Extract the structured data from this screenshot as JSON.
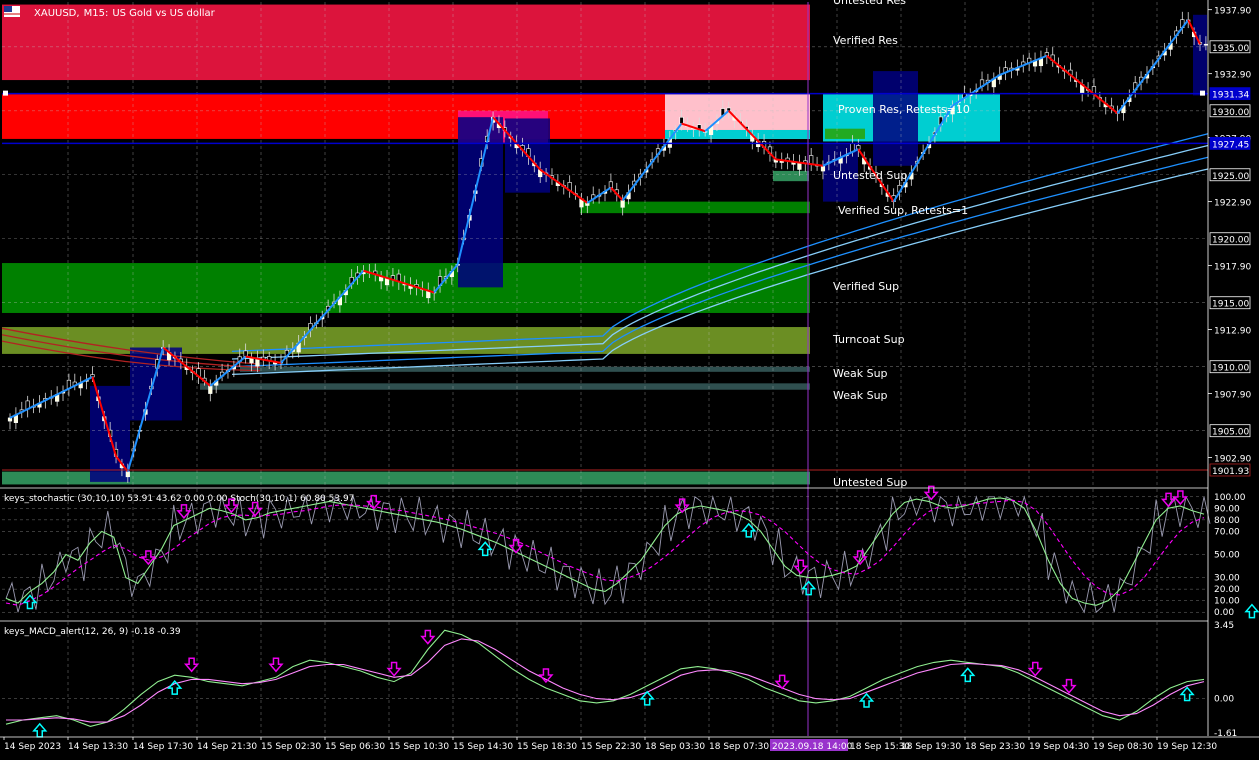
{
  "window": {
    "symbol": "XAUUSD",
    "timeframe": "M15",
    "description": "US Gold vs US dollar",
    "title_sep": ",",
    "title_sep2": ":"
  },
  "colors": {
    "bg": "#000000",
    "grid": "#c0c0c0",
    "axis": "#ffffff",
    "resistance_strong": "#dc143c",
    "resistance_proven": "#ff0000",
    "support_verified": "#008000",
    "support_turncoat": "#6b8e23",
    "support_weak": "#2f4f4f",
    "support_untested": "#2e8b57",
    "ma_blue": "#1e90ff",
    "ma_red": "#b22222",
    "zigzag_up": "#1e90ff",
    "zigzag_down": "#ff0000",
    "candle_bull": "#ffffe0",
    "candle_bear": "#ffffff",
    "stoch_main": "#90ee90",
    "stoch_signal": "#ff00ff",
    "arrow_up": "#00ffff",
    "arrow_down": "#ee00ee",
    "level_line": "#0000cd",
    "cursor_line": "#9932cc",
    "cursor_label_bg": "#9932cc"
  },
  "chart_data": [
    {
      "type": "candlestick",
      "title": "XAUUSD, M15: US Gold vs US dollar",
      "ylim": [
        1900.6,
        1938.5
      ],
      "y_ticks": [
        "1937.90",
        "1935.00",
        "1932.90",
        "1930.00",
        "1927.90",
        "1925.00",
        "1922.90",
        "1920.00",
        "1917.90",
        "1915.00",
        "1912.90",
        "1910.00",
        "1907.90",
        "1905.00",
        "1902.90",
        "1901.93"
      ],
      "price_labels_highlighted": [
        {
          "label": "1935.00",
          "value": 1935.0,
          "style": "plain"
        },
        {
          "label": "1931.34",
          "value": 1931.34,
          "style": "blue"
        },
        {
          "label": "1930.00",
          "value": 1930.0,
          "style": "plain"
        },
        {
          "label": "1927.45",
          "value": 1927.45,
          "style": "blue"
        },
        {
          "label": "1925.00",
          "value": 1925.0,
          "style": "plain"
        },
        {
          "label": "1920.00",
          "value": 1920.0,
          "style": "plain"
        },
        {
          "label": "1915.00",
          "value": 1915.0,
          "style": "plain"
        },
        {
          "label": "1910.00",
          "value": 1910.0,
          "style": "plain"
        },
        {
          "label": "1905.00",
          "value": 1905.0,
          "style": "plain"
        },
        {
          "label": "1901.93",
          "value": 1901.93,
          "style": "current"
        }
      ],
      "horizontal_lines": [
        1931.34,
        1927.45
      ],
      "zones": [
        {
          "name": "Untested Res",
          "label": "Untested Res",
          "low": 1938.5,
          "high": 1938.5,
          "kind": "untested_res"
        },
        {
          "name": "Verified Res",
          "label": "Verified Res",
          "low": 1932.4,
          "high": 1938.3,
          "kind": "resistance_strong"
        },
        {
          "name": "Proven Res",
          "label": "Proven Res, Retests=10",
          "low": 1927.8,
          "high": 1931.3,
          "kind": "resistance_proven"
        },
        {
          "name": "Untested Sup",
          "label": "Untested Sup",
          "low": 1924.8,
          "high": 1924.8,
          "kind": "untested_sup_label"
        },
        {
          "name": "Verified Sup 1",
          "label": "Verified Sup, Retests=1",
          "low": 1922.0,
          "high": 1922.9,
          "kind": "support_verified"
        },
        {
          "name": "Verified Sup 2",
          "label": "Verified Sup",
          "low": 1914.2,
          "high": 1918.1,
          "kind": "support_verified"
        },
        {
          "name": "Turncoat Sup",
          "label": "Turncoat Sup",
          "low": 1911.0,
          "high": 1913.1,
          "kind": "support_turncoat"
        },
        {
          "name": "Weak Sup 1",
          "label": "Weak Sup",
          "low": 1909.6,
          "high": 1910.0,
          "kind": "support_weak"
        },
        {
          "name": "Weak Sup 2",
          "label": "Weak Sup",
          "low": 1908.2,
          "high": 1908.7,
          "kind": "support_weak"
        },
        {
          "name": "Untested Sup 2",
          "label": "Untested Sup",
          "low": 1900.8,
          "high": 1901.8,
          "kind": "support_untested"
        }
      ],
      "x_labels": [
        "14 Sep 2023",
        "14 Sep 13:30",
        "14 Sep 17:30",
        "14 Sep 21:30",
        "15 Sep 02:30",
        "15 Sep 06:30",
        "15 Sep 10:30",
        "15 Sep 14:30",
        "15 Sep 18:30",
        "15 Sep 22:30",
        "18 Sep 03:30",
        "18 Sep 07:30",
        "2023.09.18 14:00",
        "18 Sep 15:30",
        "18 Sep 19:30",
        "18 Sep 23:30",
        "19 Sep 04:30",
        "19 Sep 08:30",
        "19 Sep 12:30"
      ],
      "cursor_label": "2023.09.18 14:00",
      "zigzag": [
        [
          0,
          1906.0
        ],
        [
          7,
          1909.2
        ],
        [
          9,
          1903.0
        ],
        [
          10,
          1901.8
        ],
        [
          13,
          1911.5
        ],
        [
          17,
          1908.5
        ],
        [
          20,
          1910.8
        ],
        [
          23,
          1910.3
        ],
        [
          30,
          1917.5
        ],
        [
          36,
          1915.8
        ],
        [
          38,
          1918.0
        ],
        [
          41,
          1929.5
        ],
        [
          45,
          1925.4
        ],
        [
          49,
          1922.8
        ],
        [
          51,
          1924.0
        ],
        [
          52,
          1923.0
        ],
        [
          57,
          1929.0
        ],
        [
          59,
          1928.4
        ],
        [
          61,
          1930.0
        ],
        [
          65,
          1926.2
        ],
        [
          69,
          1925.7
        ],
        [
          72,
          1927.0
        ],
        [
          75,
          1922.9
        ],
        [
          80,
          1930.4
        ],
        [
          84,
          1932.8
        ],
        [
          88,
          1934.3
        ],
        [
          94,
          1929.8
        ],
        [
          100,
          1937.1
        ],
        [
          101,
          1935.2
        ]
      ],
      "close_series_note": "price path",
      "overlay_labels": {
        "untested_res": "Untested Res",
        "verified_res": "Verified Res",
        "proven_res": "Proven Res, Retests=10",
        "untested_sup": "Untested Sup",
        "verified_sup_retests": "Verified Sup, Retests=1",
        "verified_sup": "Verified Sup",
        "turncoat_sup": "Turncoat Sup",
        "weak_sup_1": "Weak Sup",
        "weak_sup_2": "Weak Sup",
        "untested_sup_bottom": "Untested Sup"
      }
    },
    {
      "type": "line",
      "title": "keys_stochastic (30,10,10) 53.91 43.62 0.00 0.00 Stoch(30,10,1) 60.80 53.97",
      "ylim": [
        -5,
        105
      ],
      "y_ticks": [
        "100.00",
        "90.00",
        "80.00",
        "70.00",
        "50.00",
        "30.00",
        "20.00",
        "10.00",
        "0.00"
      ],
      "levels": [
        100,
        90,
        80,
        70,
        50,
        30,
        20,
        10,
        0
      ],
      "series": [
        {
          "name": "main",
          "values": [
            12,
            8,
            18,
            25,
            35,
            50,
            45,
            60,
            70,
            65,
            30,
            25,
            40,
            55,
            75,
            80,
            85,
            90,
            88,
            85,
            80,
            82,
            86,
            88,
            90,
            92,
            94,
            96,
            94,
            92,
            90,
            88,
            86,
            84,
            82,
            80,
            78,
            75,
            72,
            68,
            64,
            60,
            55,
            50,
            45,
            40,
            35,
            30,
            25,
            20,
            18,
            25,
            35,
            45,
            60,
            75,
            85,
            90,
            92,
            90,
            88,
            85,
            80,
            70,
            55,
            40,
            32,
            30,
            30,
            32,
            35,
            40,
            55,
            70,
            85,
            95,
            98,
            96,
            92,
            90,
            92,
            95,
            98,
            99,
            97,
            90,
            70,
            45,
            25,
            12,
            8,
            6,
            10,
            20,
            40,
            60,
            80,
            90,
            92,
            88,
            85
          ]
        },
        {
          "name": "signal",
          "values": [
            8,
            6,
            10,
            15,
            22,
            30,
            38,
            45,
            52,
            58,
            55,
            48,
            45,
            48,
            55,
            63,
            70,
            77,
            82,
            84,
            84,
            83,
            84,
            85,
            87,
            88,
            90,
            92,
            93,
            93,
            92,
            91,
            89,
            88,
            86,
            84,
            82,
            80,
            77,
            74,
            71,
            68,
            64,
            60,
            55,
            50,
            45,
            40,
            36,
            32,
            28,
            27,
            30,
            34,
            40,
            48,
            57,
            66,
            75,
            82,
            86,
            88,
            87,
            84,
            78,
            70,
            60,
            50,
            42,
            37,
            34,
            33,
            38,
            45,
            56,
            68,
            79,
            87,
            92,
            93,
            93,
            94,
            95,
            96,
            97,
            95,
            88,
            75,
            60,
            45,
            32,
            22,
            16,
            15,
            20,
            30,
            44,
            58,
            70,
            78,
            82
          ]
        }
      ],
      "arrows_up_x": [
        2,
        40,
        62,
        67,
        104
      ],
      "arrows_down_x": [
        12,
        15,
        19,
        21,
        31,
        43,
        57,
        67,
        72,
        78,
        98,
        99
      ]
    },
    {
      "type": "line",
      "title": "keys_MACD_alert(12, 26, 9) -0.18 -0.39",
      "ylim": [
        -1.61,
        3.45
      ],
      "y_ticks": [
        "3.45",
        "0.00",
        "-1.61"
      ],
      "series": [
        {
          "name": "macd",
          "values": [
            -1.2,
            -1.0,
            -0.9,
            -0.8,
            -1.0,
            -1.3,
            -1.1,
            -0.5,
            0.2,
            0.8,
            1.1,
            1.0,
            0.8,
            0.7,
            0.6,
            0.8,
            1.0,
            1.5,
            1.8,
            1.7,
            1.5,
            1.3,
            1.0,
            0.8,
            1.2,
            2.3,
            3.2,
            3.0,
            2.6,
            2.0,
            1.4,
            0.9,
            0.5,
            0.2,
            -0.1,
            -0.2,
            -0.1,
            0.2,
            0.6,
            1.0,
            1.4,
            1.5,
            1.4,
            1.2,
            0.9,
            0.5,
            0.2,
            -0.1,
            -0.2,
            -0.1,
            0.1,
            0.5,
            0.9,
            1.2,
            1.5,
            1.7,
            1.8,
            1.7,
            1.6,
            1.5,
            1.2,
            0.8,
            0.4,
            0.0,
            -0.4,
            -0.8,
            -1.0,
            -0.6,
            0.0,
            0.5,
            0.8,
            0.9
          ]
        },
        {
          "name": "signal",
          "values": [
            -1.0,
            -1.0,
            -0.95,
            -0.9,
            -0.95,
            -1.1,
            -1.1,
            -0.8,
            -0.3,
            0.3,
            0.7,
            0.9,
            0.9,
            0.8,
            0.7,
            0.75,
            0.9,
            1.2,
            1.5,
            1.6,
            1.6,
            1.4,
            1.2,
            1.0,
            1.1,
            1.7,
            2.5,
            2.8,
            2.7,
            2.3,
            1.8,
            1.3,
            0.9,
            0.5,
            0.2,
            0.0,
            -0.05,
            0.05,
            0.3,
            0.7,
            1.1,
            1.3,
            1.35,
            1.3,
            1.1,
            0.8,
            0.5,
            0.2,
            0.0,
            -0.05,
            0.0,
            0.3,
            0.6,
            0.9,
            1.2,
            1.4,
            1.6,
            1.65,
            1.6,
            1.55,
            1.35,
            1.0,
            0.6,
            0.2,
            -0.2,
            -0.6,
            -0.8,
            -0.7,
            -0.3,
            0.2,
            0.6,
            0.8
          ]
        }
      ],
      "arrows_up_x": [
        2,
        10,
        38,
        51,
        57,
        70
      ],
      "arrows_down_x": [
        11,
        16,
        23,
        25,
        32,
        46,
        61,
        63,
        74,
        75
      ]
    }
  ]
}
